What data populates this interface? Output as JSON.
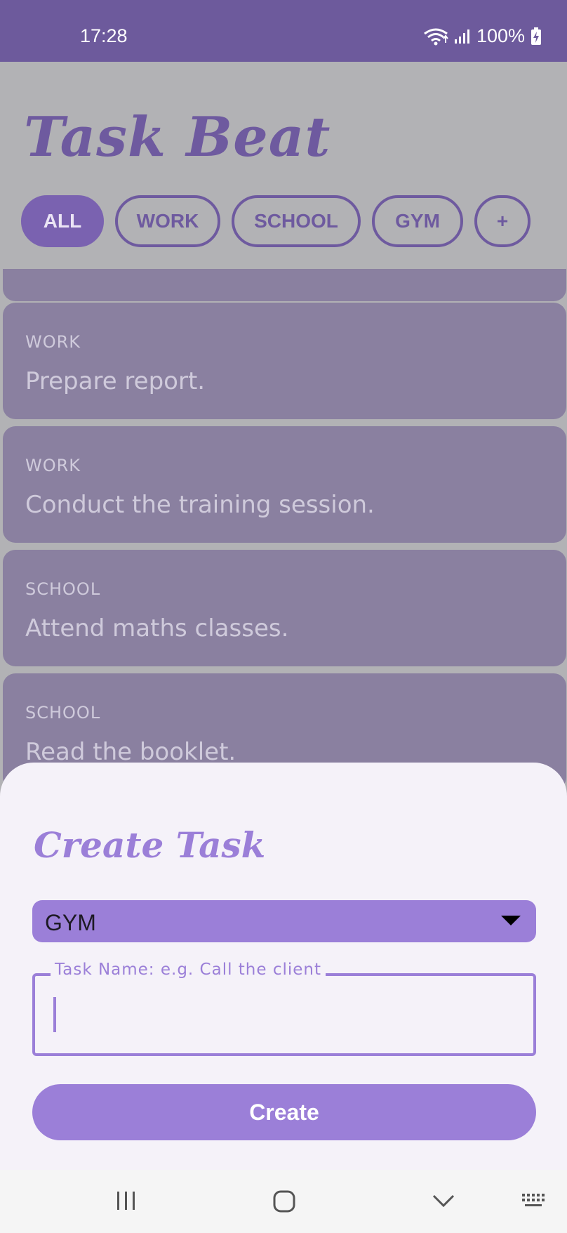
{
  "status_bar": {
    "time": "17:28",
    "battery": "100%"
  },
  "app": {
    "title": "Task Beat",
    "chips": [
      {
        "label": "ALL",
        "active": true
      },
      {
        "label": "WORK",
        "active": false
      },
      {
        "label": "SCHOOL",
        "active": false
      },
      {
        "label": "GYM",
        "active": false
      },
      {
        "label": "+",
        "active": false
      }
    ],
    "tasks": [
      {
        "category": "WORK",
        "name": "Prepare report."
      },
      {
        "category": "WORK",
        "name": "Conduct the training session."
      },
      {
        "category": "SCHOOL",
        "name": "Attend maths classes."
      },
      {
        "category": "SCHOOL",
        "name": "Read the booklet."
      }
    ]
  },
  "sheet": {
    "title": "Create Task",
    "category_selected": "GYM",
    "task_name_label": "Task Name: e.g. Call the client",
    "task_name_value": "",
    "create_label": "Create"
  },
  "colors": {
    "status_bar": "#6d5a9c",
    "accent": "#9b7fd8",
    "primary_dark": "#6e5a9f",
    "card": "#8a80a0",
    "scrim": "#b2b2b5",
    "sheet_bg": "#f5f2f9"
  },
  "icons": [
    "wifi-icon",
    "signal-icon",
    "battery-charging-icon",
    "dropdown-arrow-icon",
    "nav-recents-icon",
    "nav-home-icon",
    "nav-back-icon",
    "keyboard-icon"
  ]
}
